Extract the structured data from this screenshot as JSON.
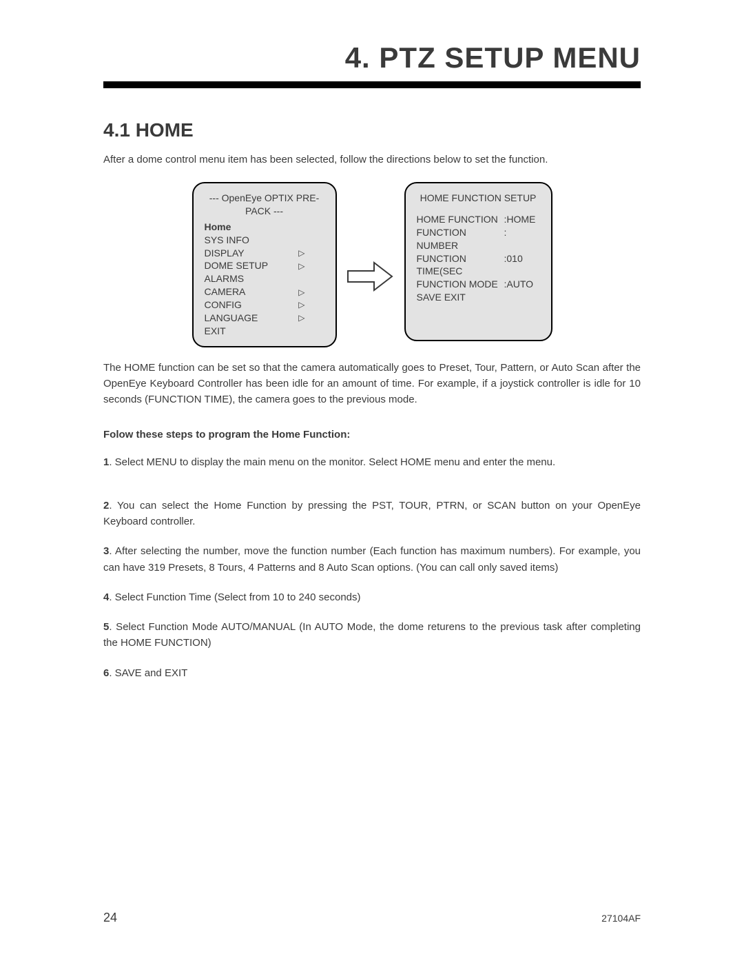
{
  "chapter": {
    "title": "4. PTZ SETUP MENU"
  },
  "section": {
    "title": "4.1 HOME"
  },
  "intro": "After a dome control menu item has been selected, follow the directions below to set the function.",
  "panel_left": {
    "title": "--- OpenEye OPTIX PRE-PACK ---",
    "items": [
      {
        "label": "Home",
        "bold": true,
        "arrow": false
      },
      {
        "label": "SYS INFO",
        "arrow": false
      },
      {
        "label": "DISPLAY",
        "arrow": true
      },
      {
        "label": "DOME SETUP",
        "arrow": true
      },
      {
        "label": "ALARMS",
        "arrow": false
      },
      {
        "label": "CAMERA",
        "arrow": true
      },
      {
        "label": "CONFIG",
        "arrow": true
      },
      {
        "label": "LANGUAGE",
        "arrow": true
      },
      {
        "label": "EXIT",
        "arrow": false
      }
    ]
  },
  "panel_right": {
    "title": "HOME FUNCTION SETUP",
    "rows": [
      {
        "k": "HOME FUNCTION",
        "v": ":HOME"
      },
      {
        "k": "FUNCTION NUMBER",
        "v": ":"
      },
      {
        "k": "FUNCTION TIME(SEC",
        "v": ":010"
      },
      {
        "k": "FUNCTION MODE",
        "v": ":AUTO"
      },
      {
        "k": "SAVE EXIT",
        "v": ""
      }
    ]
  },
  "body_text": "The HOME function can be set so that the camera automatically goes to Preset, Tour, Pattern, or Auto Scan after the OpenEye Keyboard Controller has been idle for an amount of time. For example, if a joystick controller is idle for 10 seconds (FUNCTION TIME), the camera goes to the previous mode.",
  "steps_heading": "Folow these steps to program the Home Function:",
  "steps": [
    {
      "num": "1",
      "text": ". Select MENU to display the main menu on the monitor. Select HOME menu and enter the menu."
    },
    {
      "num": "2",
      "text": ". You can select the Home Function by pressing the PST, TOUR, PTRN, or SCAN button on your OpenEye Keyboard controller."
    },
    {
      "num": "3",
      "text": ". After selecting the number, move the function number (Each function has maximum numbers). For example, you can have 319 Presets, 8 Tours, 4 Patterns and 8 Auto Scan options. (You can call only saved items)"
    },
    {
      "num": "4",
      "text": ". Select Function Time (Select from 10 to 240 seconds)"
    },
    {
      "num": "5",
      "text": ". Select Function Mode AUTO/MANUAL (In AUTO Mode, the dome returens to the previous task after completing the HOME FUNCTION)"
    },
    {
      "num": "6",
      "text": ". SAVE and EXIT"
    }
  ],
  "footer": {
    "page": "24",
    "code": "27104AF"
  },
  "glyphs": {
    "tri": "▷"
  }
}
